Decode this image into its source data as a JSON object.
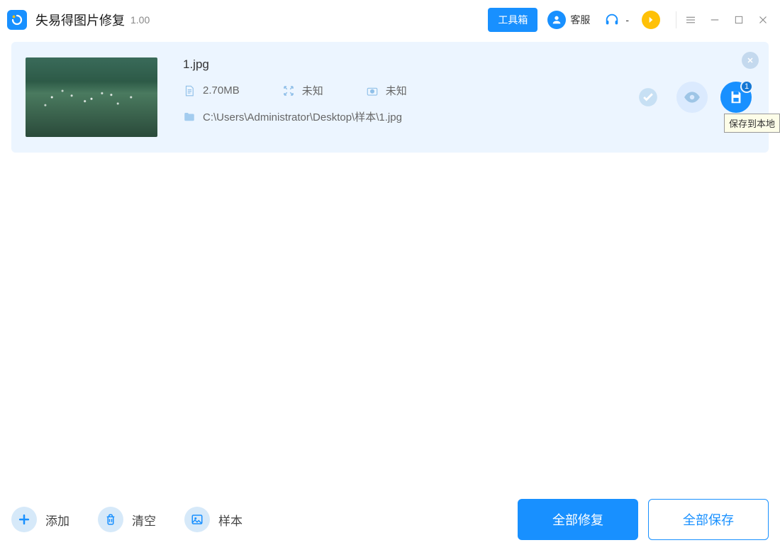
{
  "app": {
    "title": "失易得图片修复",
    "version": "1.00"
  },
  "header": {
    "toolbox": "工具箱",
    "support": "客服",
    "phone_label": "-"
  },
  "file": {
    "name": "1.jpg",
    "size": "2.70MB",
    "dimension": "未知",
    "extra": "未知",
    "path": "C:\\Users\\Administrator\\Desktop\\样本\\1.jpg",
    "badge": "1"
  },
  "tooltip": {
    "save_local": "保存到本地"
  },
  "footer": {
    "add": "添加",
    "clear": "清空",
    "sample": "样本",
    "repair_all": "全部修复",
    "save_all": "全部保存"
  }
}
